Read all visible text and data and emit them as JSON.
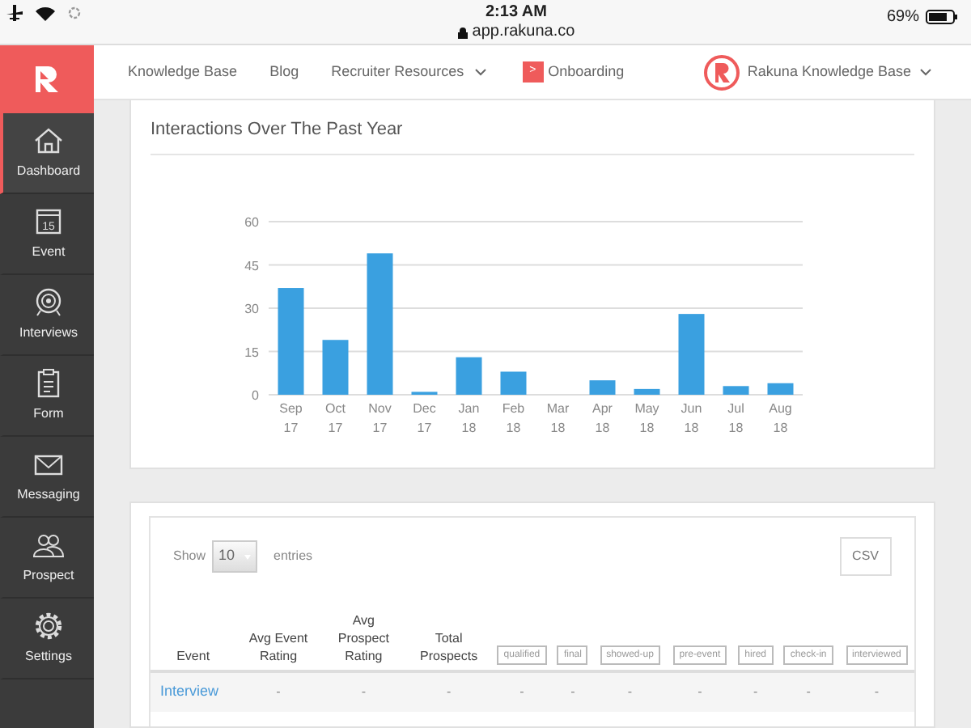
{
  "status_bar": {
    "time": "2:13 AM",
    "url": "app.rakuna.co",
    "battery": "69%"
  },
  "nav": {
    "links": [
      {
        "label": "Knowledge Base",
        "kind": "plain"
      },
      {
        "label": "Blog",
        "kind": "plain"
      },
      {
        "label": "Recruiter Resources",
        "kind": "dropdown"
      },
      {
        "label": "Onboarding",
        "kind": "badge",
        "badge": ">"
      }
    ],
    "account": "Rakuna Knowledge Base"
  },
  "sidebar": {
    "items": [
      {
        "label": "Dashboard",
        "selected": true
      },
      {
        "label": "Event",
        "selected": false,
        "icon_text": "15"
      },
      {
        "label": "Interviews",
        "selected": false
      },
      {
        "label": "Form",
        "selected": false
      },
      {
        "label": "Messaging",
        "selected": false
      },
      {
        "label": "Prospect",
        "selected": false
      },
      {
        "label": "Settings",
        "selected": false
      }
    ]
  },
  "chart_card": {
    "title": "Interactions Over The Past Year",
    "chart_data": {
      "type": "bar",
      "categories": [
        "Sep 17",
        "Oct 17",
        "Nov 17",
        "Dec 17",
        "Jan 18",
        "Feb 18",
        "Mar 18",
        "Apr 18",
        "May 18",
        "Jun 18",
        "Jul 18",
        "Aug 18"
      ],
      "values": [
        37,
        19,
        49,
        1,
        13,
        8,
        0,
        5,
        2,
        28,
        3,
        4
      ],
      "grid": true,
      "ylim": [
        0,
        60
      ],
      "yticks": [
        0,
        15,
        30,
        45,
        60
      ]
    }
  },
  "table": {
    "show_label": "Show",
    "page_size": "10",
    "entries_label": "entries",
    "csv_button": "CSV",
    "columns": [
      {
        "label": "Event",
        "kind": "text"
      },
      {
        "label": "Avg Event Rating",
        "kind": "text"
      },
      {
        "label": "Avg Prospect Rating",
        "kind": "text"
      },
      {
        "label": "Total Prospects",
        "kind": "text"
      },
      {
        "label": "qualified",
        "kind": "tag"
      },
      {
        "label": "final",
        "kind": "tag"
      },
      {
        "label": "showed-up",
        "kind": "tag"
      },
      {
        "label": "pre-event",
        "kind": "tag"
      },
      {
        "label": "hired",
        "kind": "tag"
      },
      {
        "label": "check-in",
        "kind": "tag"
      },
      {
        "label": "interviewed",
        "kind": "tag"
      }
    ],
    "rows": [
      [
        "Interview",
        "-",
        "-",
        "-",
        "-",
        "-",
        "-",
        "-",
        "-",
        "-",
        "-"
      ]
    ]
  }
}
